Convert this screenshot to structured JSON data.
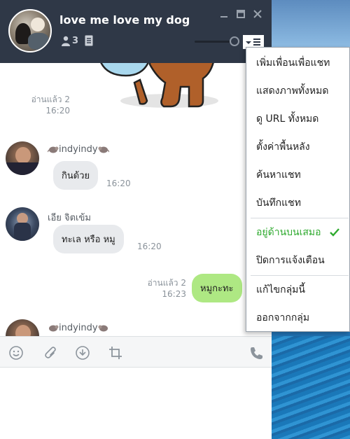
{
  "header": {
    "title": "love me love my dog",
    "member_count": "3",
    "icons": [
      "member-icon",
      "note-icon",
      "minimize-icon",
      "maximize-icon",
      "close-icon",
      "menu-icon"
    ]
  },
  "messages": [
    {
      "type": "read",
      "read_label": "อ่านแล้ว 2",
      "time": "16:20"
    },
    {
      "type": "incoming",
      "sender": "indyindy",
      "text": "กินด้วย",
      "time": "16:20"
    },
    {
      "type": "incoming",
      "sender": "เอีย จิตเข้ม",
      "text": "ทะเล หรือ หมู",
      "time": "16:20"
    },
    {
      "type": "outgoing",
      "read_label": "อ่านแล้ว 2",
      "text": "หมูกะทะ",
      "time": "16:23"
    },
    {
      "type": "incoming",
      "sender": "indyindy"
    }
  ],
  "toolbar": {
    "icons": [
      "emoji-icon",
      "attach-icon",
      "download-icon",
      "crop-icon",
      "phone-icon"
    ]
  },
  "menu": {
    "items": [
      "เพิ่มเพื่อนเพื่อแชท",
      "แสดงภาพทั้งหมด",
      "ดู URL ทั้งหมด",
      "ตั้งค่าพื้นหลัง",
      "ค้นหาแชท",
      "บันทึกแชท",
      "อยู่ด้านบนเสมอ",
      "ปิดการแจ้งเตือน",
      "แก้ไขกลุ่มนี้",
      "ออกจากกลุ่ม"
    ],
    "checked_item": "อยู่ด้านบนเสมอ"
  },
  "colors": {
    "header_bg": "#2f3847",
    "outgoing_bubble": "#aee883",
    "incoming_bubble": "#e8eaed",
    "checked_green": "#2faa2f"
  }
}
